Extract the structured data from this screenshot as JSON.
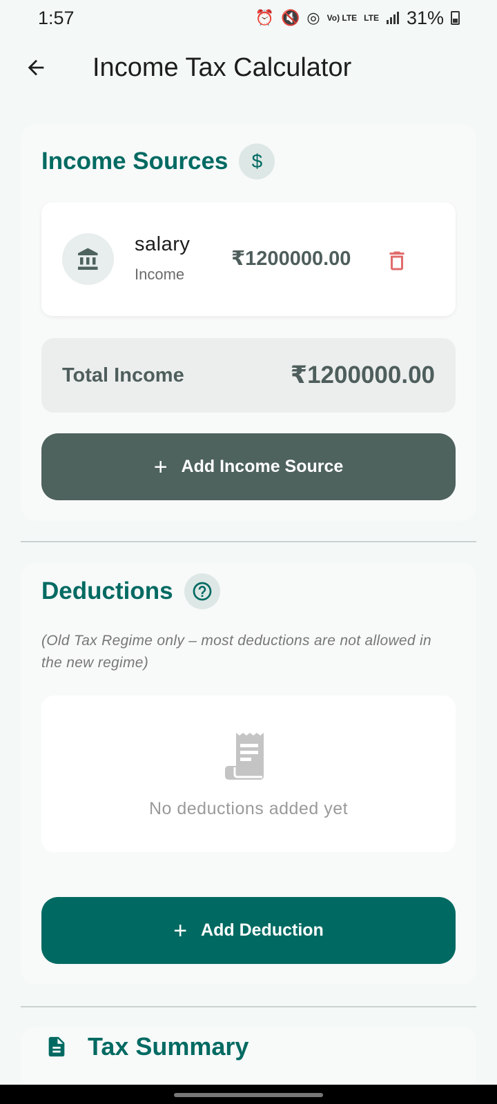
{
  "status_bar": {
    "time": "1:57",
    "battery": "31%",
    "icons": [
      "alarm-icon",
      "mute-icon",
      "hotspot-icon",
      "volte-icon",
      "lte-icon",
      "signal-icon",
      "battery-icon"
    ],
    "volte_label": "Vo) LTE",
    "lte_label": "LTE"
  },
  "app_bar": {
    "title": "Income Tax Calculator"
  },
  "income_sources": {
    "title": "Income Sources",
    "badge_symbol": "$",
    "items": [
      {
        "name": "salary",
        "type": "Income",
        "amount": "₹1200000.00"
      }
    ],
    "total_label": "Total Income",
    "total_value": "₹1200000.00",
    "add_button_label": "Add Income Source"
  },
  "deductions": {
    "title": "Deductions",
    "badge_symbol": "?",
    "note": "(Old Tax Regime only – most deductions are not allowed in the new regime)",
    "empty_text": "No deductions added yet",
    "add_button_label": "Add Deduction"
  },
  "tax_summary": {
    "title": "Tax Summary"
  },
  "colors": {
    "accent": "#006a62",
    "secondary_button": "#4e625e",
    "delete": "#e06b6b",
    "background": "#f4f8f7"
  }
}
